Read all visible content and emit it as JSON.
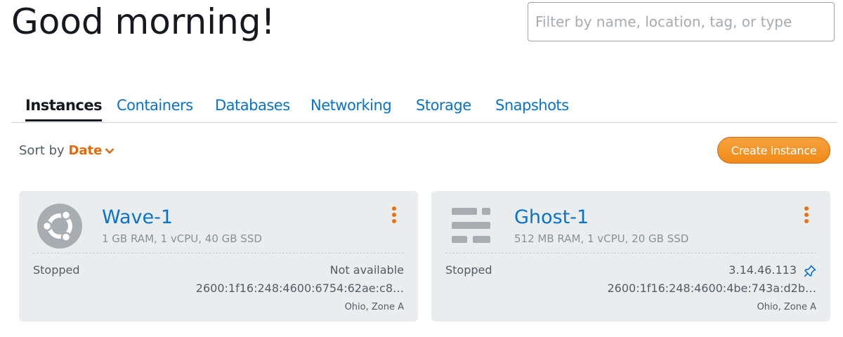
{
  "header": {
    "greeting": "Good morning!",
    "filter_placeholder": "Filter by name, location, tag, or type"
  },
  "tabs": [
    {
      "label": "Instances",
      "active": true
    },
    {
      "label": "Containers"
    },
    {
      "label": "Databases"
    },
    {
      "label": "Networking"
    },
    {
      "label": "Storage"
    },
    {
      "label": "Snapshots"
    }
  ],
  "toolbar": {
    "sort_label": "Sort by",
    "sort_value": "Date",
    "create_label": "Create instance"
  },
  "instances": [
    {
      "name": "Wave-1",
      "specs": "1 GB RAM, 1 vCPU, 40 GB SSD",
      "state": "Stopped",
      "ip": "Not available",
      "ipv6": "2600:1f16:248:4600:6754:62ae:c8…",
      "zone": "Ohio, Zone A",
      "icon": "ubuntu-icon"
    },
    {
      "name": "Ghost-1",
      "specs": "512 MB RAM, 1 vCPU, 20 GB SSD",
      "state": "Stopped",
      "ip": "3.14.46.113",
      "ipv6": "2600:1f16:248:4600:4be:743a:d2b…",
      "zone": "Ohio, Zone A",
      "icon": "ghost-icon",
      "static_ip": true
    }
  ],
  "colors": {
    "link": "#0b73c7",
    "accent": "#ec7211",
    "card_bg": "#eaeded",
    "text_muted": "#545b64"
  }
}
